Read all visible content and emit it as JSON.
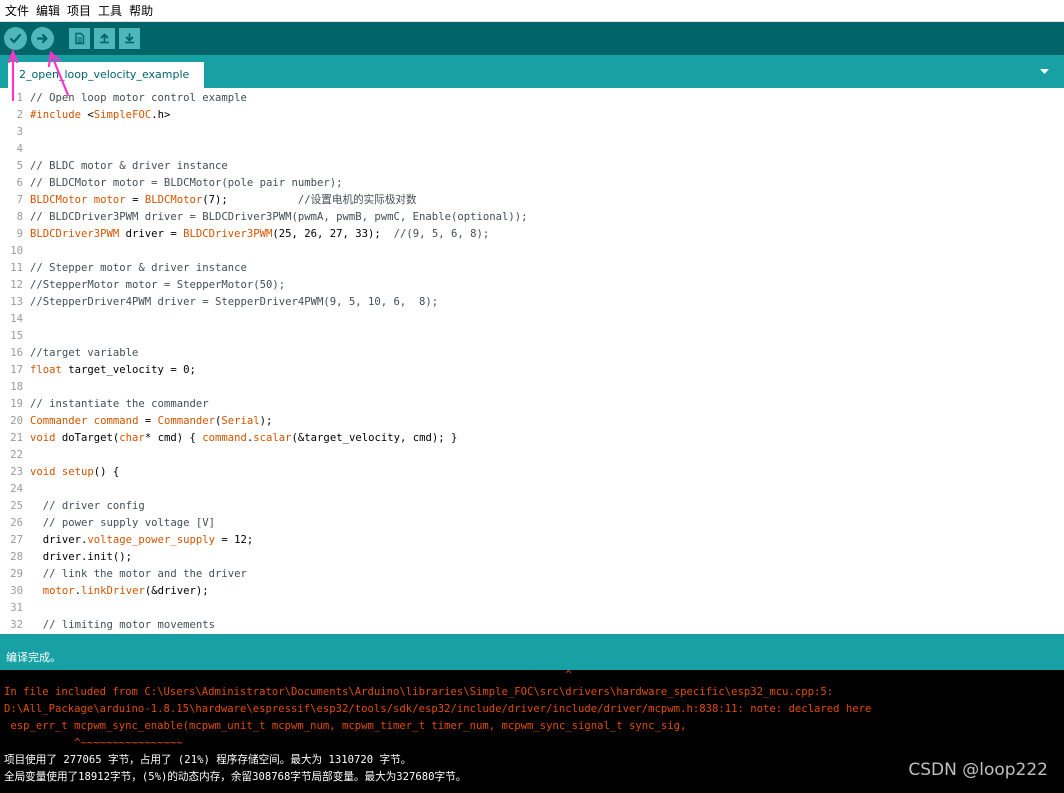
{
  "menu": [
    "文件",
    "编辑",
    "项目",
    "工具",
    "帮助"
  ],
  "toolbar": {
    "buttons": [
      {
        "name": "verify-button",
        "icon": "checkmark-icon"
      },
      {
        "name": "upload-button",
        "icon": "arrow-right-icon"
      },
      {
        "name": "new-button",
        "icon": "document-icon"
      },
      {
        "name": "open-button",
        "icon": "arrow-up-icon"
      },
      {
        "name": "save-button",
        "icon": "arrow-down-icon"
      }
    ]
  },
  "tab": {
    "label": "2_open_loop_velocity_example"
  },
  "code": [
    {
      "n": "1",
      "t": "// Open loop motor control example"
    },
    {
      "n": "2",
      "t": "#include <SimpleFOC.h>"
    },
    {
      "n": "3",
      "t": ""
    },
    {
      "n": "4",
      "t": ""
    },
    {
      "n": "5",
      "t": "// BLDC motor & driver instance"
    },
    {
      "n": "6",
      "t": "// BLDCMotor motor = BLDCMotor(pole pair number);"
    },
    {
      "n": "7",
      "t": "BLDCMotor motor = BLDCMotor(7);           //设置电机的实际极对数"
    },
    {
      "n": "8",
      "t": "// BLDCDriver3PWM driver = BLDCDriver3PWM(pwmA, pwmB, pwmC, Enable(optional));"
    },
    {
      "n": "9",
      "t": "BLDCDriver3PWM driver = BLDCDriver3PWM(25, 26, 27, 33);  //(9, 5, 6, 8);"
    },
    {
      "n": "10",
      "t": ""
    },
    {
      "n": "11",
      "t": "// Stepper motor & driver instance"
    },
    {
      "n": "12",
      "t": "//StepperMotor motor = StepperMotor(50);"
    },
    {
      "n": "13",
      "t": "//StepperDriver4PWM driver = StepperDriver4PWM(9, 5, 10, 6,  8);"
    },
    {
      "n": "14",
      "t": ""
    },
    {
      "n": "15",
      "t": ""
    },
    {
      "n": "16",
      "t": "//target variable"
    },
    {
      "n": "17",
      "t": "float target_velocity = 0;"
    },
    {
      "n": "18",
      "t": ""
    },
    {
      "n": "19",
      "t": "// instantiate the commander"
    },
    {
      "n": "20",
      "t": "Commander command = Commander(Serial);"
    },
    {
      "n": "21",
      "t": "void doTarget(char* cmd) { command.scalar(&target_velocity, cmd); }"
    },
    {
      "n": "22",
      "t": ""
    },
    {
      "n": "23",
      "t": "void setup() {"
    },
    {
      "n": "24",
      "t": ""
    },
    {
      "n": "25",
      "t": "  // driver config"
    },
    {
      "n": "26",
      "t": "  // power supply voltage [V]"
    },
    {
      "n": "27",
      "t": "  driver.voltage_power_supply = 12;"
    },
    {
      "n": "28",
      "t": "  driver.init();"
    },
    {
      "n": "29",
      "t": "  // link the motor and the driver"
    },
    {
      "n": "30",
      "t": "  motor.linkDriver(&driver);"
    },
    {
      "n": "31",
      "t": ""
    },
    {
      "n": "32",
      "t": "  // limiting motor movements"
    }
  ],
  "status": {
    "text": "编译完成。"
  },
  "console": {
    "lines": [
      {
        "t": "                                                                                        ^",
        "kind": "err"
      },
      {
        "t": "In file included from C:\\Users\\Administrator\\Documents\\Arduino\\libraries\\Simple_FOC\\src\\drivers\\hardware_specific\\esp32_mcu.cpp:5:",
        "kind": "err"
      },
      {
        "t": "D:\\All_Package\\arduino-1.8.15\\hardware\\espressif\\esp32/tools/sdk/esp32/include/driver/include/driver/mcpwm.h:838:11: note: declared here",
        "kind": "err"
      },
      {
        "t": " esp_err_t mcpwm_sync_enable(mcpwm_unit_t mcpwm_num, mcpwm_timer_t timer_num, mcpwm_sync_signal_t sync_sig,",
        "kind": "err"
      },
      {
        "t": "           ^~~~~~~~~~~~~~~~~",
        "kind": "err"
      },
      {
        "t": "项目使用了 277065 字节，占用了 (21%) 程序存储空间。最大为 1310720 字节。",
        "kind": "ok"
      },
      {
        "t": "全局变量使用了18912字节，(5%)的动态内存，余留308768字节局部变量。最大为327680字节。",
        "kind": "ok"
      }
    ],
    "watermark": "CSDN @loop222"
  },
  "colors": {
    "toolbar_bg": "#006468",
    "tabbar_bg": "#17a1a5",
    "button_bg": "#4db7bb",
    "keyword": "#d35400",
    "console_error": "#e34c00",
    "annotation_arrow": "#ff33cc"
  }
}
